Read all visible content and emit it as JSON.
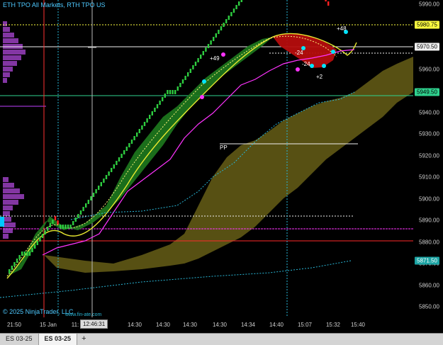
{
  "header": {
    "instrument_text": "ETH TPO All Markets, RTH TPO US"
  },
  "footer": {
    "copyright": "© 2025 NinjaTrader, LLC",
    "url_text": "www.fin-ate.com"
  },
  "y_axis": {
    "labels": [
      "5990.00",
      "5980.00",
      "5970.00",
      "5960.00",
      "5950.00",
      "5940.00",
      "5930.00",
      "5920.00",
      "5910.00",
      "5900.00",
      "5890.00",
      "5880.00",
      "5870.00",
      "5860.00",
      "5850.00"
    ],
    "flags": [
      {
        "text": "5980.75",
        "bg": "#ffff40",
        "fg": "#000000"
      },
      {
        "text": "5970.50",
        "bg": "#f0f0f0",
        "fg": "#000000"
      },
      {
        "text": "5949.50",
        "bg": "#2fd38f",
        "fg": "#000000"
      },
      {
        "text": "5871.50",
        "bg": "#1aa3a3",
        "fg": "#ffffff"
      }
    ]
  },
  "x_axis": {
    "labels": [
      "21:50",
      "15 Jan",
      "11:",
      "14:30",
      "14:30",
      "14:30",
      "14:30",
      "14:34",
      "14:40",
      "15:07",
      "15:32",
      "15:40"
    ],
    "cursor_time": "12:46:31"
  },
  "annotations": {
    "pp": "PP",
    "plus49": "+49",
    "plus48": "+48",
    "minus24a": "-24",
    "minus24b": "-24",
    "plus2": "+2"
  },
  "tabs": [
    {
      "label": "ES 03-25",
      "active": false
    },
    {
      "label": "ES 03-25",
      "active": true
    }
  ],
  "add_tab_label": "+",
  "colors": {
    "background": "#000000",
    "bull_candle": "#2ecc40",
    "bear_candle": "#ff2020",
    "cloud_bull": "#1e7a1e",
    "cloud_bear": "#b50d0d",
    "ichimoku_cloud": "#5c5414",
    "magenta_line": "#ff33ff",
    "cyan_dotted": "#29b6d6",
    "yellow_line": "#e8e830",
    "profile_purple": "#9a3fbf",
    "poc_cyan": "#00c8ff"
  }
}
